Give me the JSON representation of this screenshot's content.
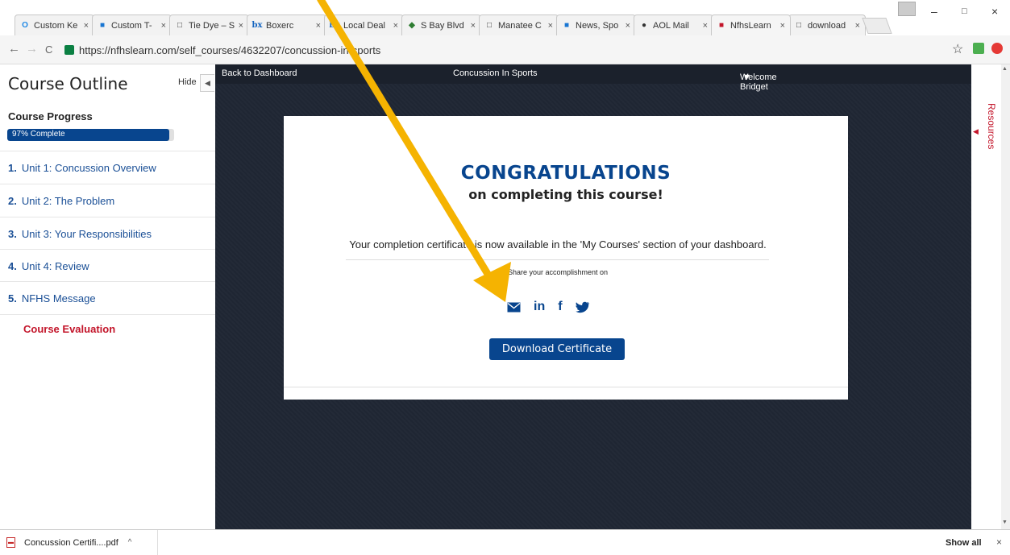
{
  "browser": {
    "tabs": [
      {
        "label": "Custom Ke",
        "favicon": "O",
        "color": "#1e88e5"
      },
      {
        "label": "Custom T-",
        "favicon": "■",
        "color": "#1976d2"
      },
      {
        "label": "Tie Dye – S",
        "favicon": "□",
        "color": "#555"
      },
      {
        "label": "Boxerc",
        "favicon": "bx",
        "color": "#1565c0"
      },
      {
        "label": "Local Deal",
        "favicon": "bx",
        "color": "#1565c0"
      },
      {
        "label": "S Bay Blvd",
        "favicon": "◆",
        "color": "#2e7d32"
      },
      {
        "label": "Manatee C",
        "favicon": "□",
        "color": "#555"
      },
      {
        "label": "News, Spo",
        "favicon": "■",
        "color": "#1976d2"
      },
      {
        "label": "AOL Mail",
        "favicon": "●",
        "color": "#333"
      },
      {
        "label": "NfhsLearn",
        "favicon": "■",
        "color": "#c3152a"
      },
      {
        "label": "download",
        "favicon": "□",
        "color": "#555"
      }
    ],
    "close_glyph": "×",
    "url": "https://nfhslearn.com/self_courses/4632207/concussion-in-sports",
    "window_controls": {
      "minimize": "–",
      "restore": "□",
      "close": "×"
    },
    "nav": {
      "back": "←",
      "forward": "→",
      "reload": "C"
    },
    "star": "☆"
  },
  "sidebar": {
    "title": "Course Outline",
    "hide_label": "Hide",
    "hide_arrow": "◀",
    "progress_title": "Course Progress",
    "progress_text": "97% Complete",
    "progress_value": 0.97,
    "units": [
      {
        "num": "1.",
        "label": "Unit 1: Concussion Overview"
      },
      {
        "num": "2.",
        "label": "Unit 2: The Problem"
      },
      {
        "num": "3.",
        "label": "Unit 3: Your Responsibilities"
      },
      {
        "num": "4.",
        "label": "Unit 4: Review"
      },
      {
        "num": "5.",
        "label": "NFHS Message"
      }
    ],
    "evaluation": "Course Evaluation"
  },
  "main": {
    "back_link": "Back to Dashboard",
    "course_title": "Concussion In Sports",
    "welcome": "Welcome Bridget",
    "caret": "▼",
    "heading": "CONGRATULATIONS",
    "subheading": "on completing this course!",
    "certificate_message": "Your completion certificate is now available in the 'My Courses' section of your dashboard.",
    "share_label": "Share your accomplishment on",
    "social_icons": [
      "email-icon",
      "linkedin-icon",
      "facebook-icon",
      "twitter-icon"
    ],
    "social_glyphs": {
      "linkedin": "in",
      "facebook": "f"
    },
    "download_button": "Download Certificate"
  },
  "resources": {
    "label": "Resources",
    "arrow": "◀"
  },
  "scrollbar": {
    "up": "▲",
    "down": "▼"
  },
  "annotation": {
    "color": "#f5b301"
  },
  "download_bar": {
    "file_name": "Concussion Certifi....pdf",
    "caret": "^",
    "show_all": "Show all",
    "close": "×"
  }
}
